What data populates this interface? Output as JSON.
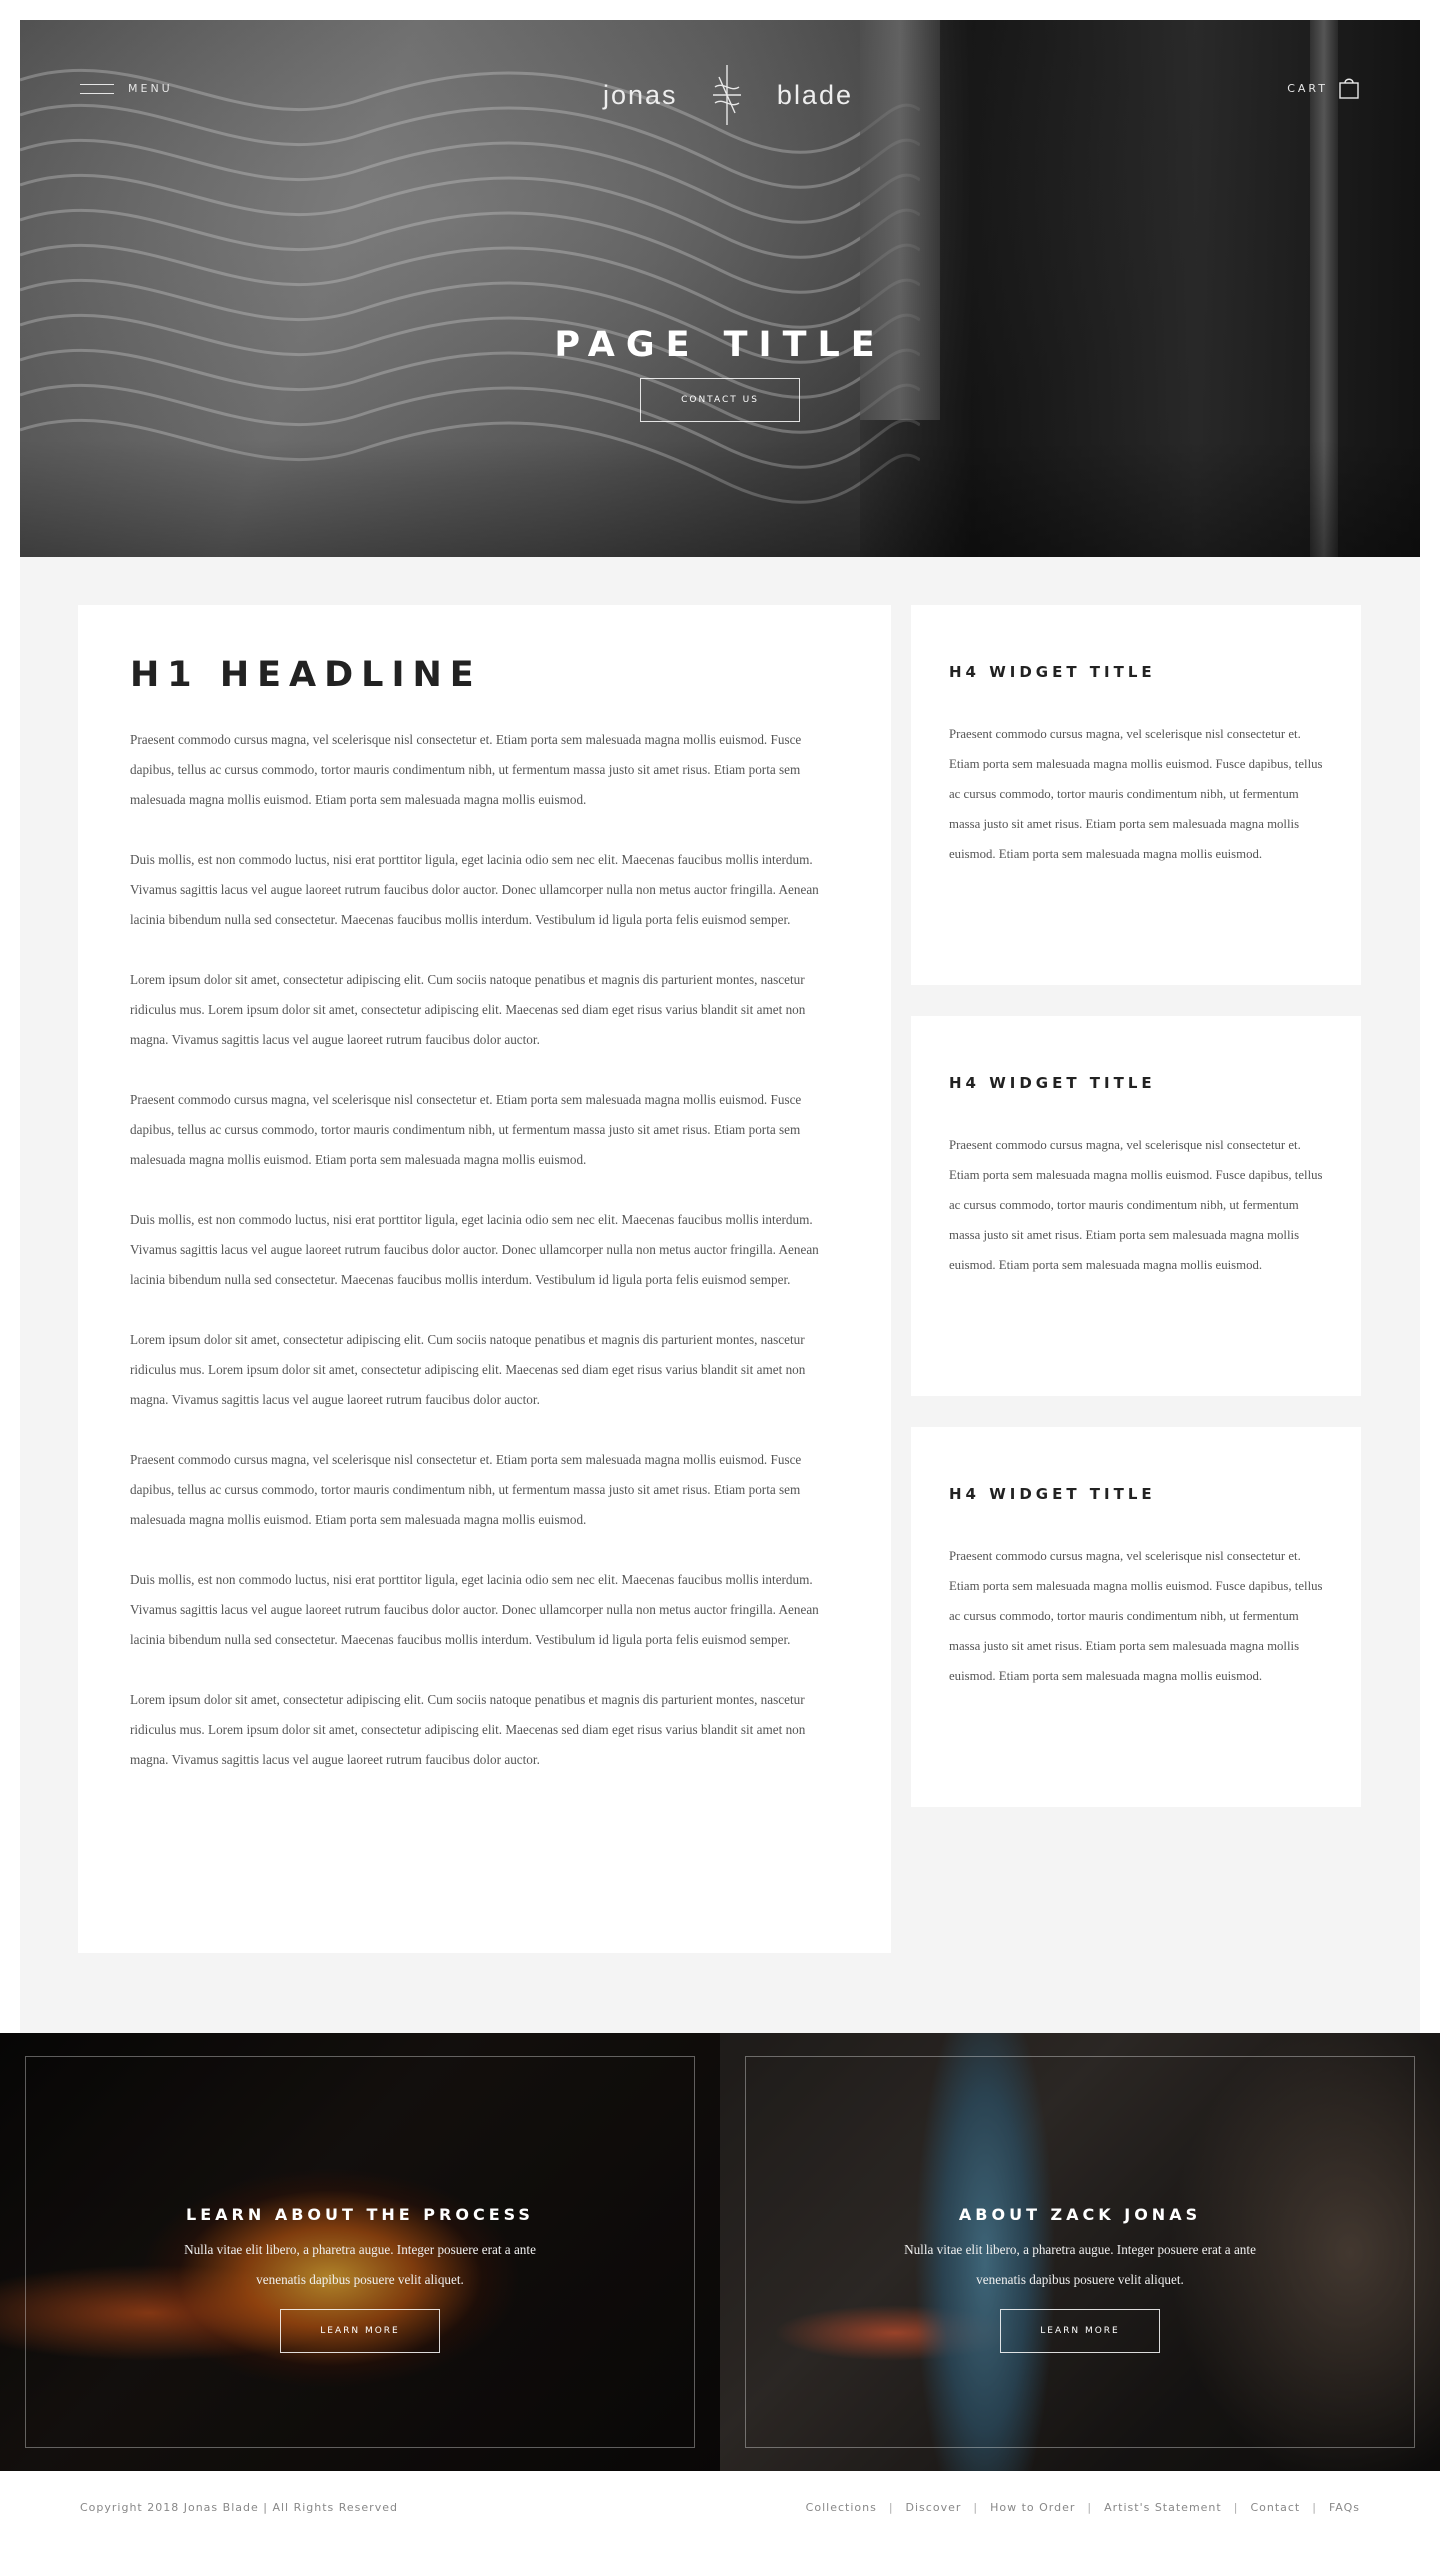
{
  "header": {
    "menu_label": "MENU",
    "logo_left": "jonas",
    "logo_right": "blade",
    "cart_label": "CART"
  },
  "hero": {
    "title": "PAGE TITLE",
    "cta_label": "CONTACT US"
  },
  "main": {
    "headline": "H1 HEADLINE",
    "paragraphs": [
      "Praesent commodo cursus magna, vel scelerisque nisl consectetur et. Etiam porta sem malesuada magna mollis euismod. Fusce dapibus, tellus ac cursus commodo, tortor mauris condimentum nibh, ut fermentum massa justo sit amet risus. Etiam porta sem malesuada magna mollis euismod. Etiam porta sem malesuada magna mollis euismod.",
      "Duis mollis, est non commodo luctus, nisi erat porttitor ligula, eget lacinia odio sem nec elit. Maecenas faucibus mollis interdum. Vivamus sagittis lacus vel augue laoreet rutrum faucibus dolor auctor. Donec ullamcorper nulla non metus auctor fringilla. Aenean lacinia bibendum nulla sed consectetur. Maecenas faucibus mollis interdum. Vestibulum id ligula porta felis euismod semper.",
      "Lorem ipsum dolor sit amet, consectetur adipiscing elit. Cum sociis natoque penatibus et magnis dis parturient montes, nascetur ridiculus mus. Lorem ipsum dolor sit amet, consectetur adipiscing elit. Maecenas sed diam eget risus varius blandit sit amet non magna. Vivamus sagittis lacus vel augue laoreet rutrum faucibus dolor auctor.",
      "Praesent commodo cursus magna, vel scelerisque nisl consectetur et. Etiam porta sem malesuada magna mollis euismod. Fusce dapibus, tellus ac cursus commodo, tortor mauris condimentum nibh, ut fermentum massa justo sit amet risus. Etiam porta sem malesuada magna mollis euismod. Etiam porta sem malesuada magna mollis euismod.",
      "Duis mollis, est non commodo luctus, nisi erat porttitor ligula, eget lacinia odio sem nec elit. Maecenas faucibus mollis interdum. Vivamus sagittis lacus vel augue laoreet rutrum faucibus dolor auctor. Donec ullamcorper nulla non metus auctor fringilla. Aenean lacinia bibendum nulla sed consectetur. Maecenas faucibus mollis interdum. Vestibulum id ligula porta felis euismod semper.",
      "Lorem ipsum dolor sit amet, consectetur adipiscing elit. Cum sociis natoque penatibus et magnis dis parturient montes, nascetur ridiculus mus. Lorem ipsum dolor sit amet, consectetur adipiscing elit. Maecenas sed diam eget risus varius blandit sit amet non magna. Vivamus sagittis lacus vel augue laoreet rutrum faucibus dolor auctor.",
      "Praesent commodo cursus magna, vel scelerisque nisl consectetur et. Etiam porta sem malesuada magna mollis euismod. Fusce dapibus, tellus ac cursus commodo, tortor mauris condimentum nibh, ut fermentum massa justo sit amet risus. Etiam porta sem malesuada magna mollis euismod. Etiam porta sem malesuada magna mollis euismod.",
      "Duis mollis, est non commodo luctus, nisi erat porttitor ligula, eget lacinia odio sem nec elit. Maecenas faucibus mollis interdum. Vivamus sagittis lacus vel augue laoreet rutrum faucibus dolor auctor. Donec ullamcorper nulla non metus auctor fringilla. Aenean lacinia bibendum nulla sed consectetur. Maecenas faucibus mollis interdum. Vestibulum id ligula porta felis euismod semper.",
      "Lorem ipsum dolor sit amet, consectetur adipiscing elit. Cum sociis natoque penatibus et magnis dis parturient montes, nascetur ridiculus mus. Lorem ipsum dolor sit amet, consectetur adipiscing elit. Maecenas sed diam eget risus varius blandit sit amet non magna. Vivamus sagittis lacus vel augue laoreet rutrum faucibus dolor auctor."
    ]
  },
  "widgets": [
    {
      "title": "H4 WIDGET TITLE",
      "text": "Praesent commodo cursus magna, vel scelerisque nisl consectetur et. Etiam porta sem malesuada magna mollis euismod. Fusce dapibus, tellus ac cursus commodo, tortor mauris condimentum nibh, ut fermentum massa justo sit amet risus. Etiam porta sem malesuada magna mollis euismod. Etiam porta sem malesuada magna mollis euismod."
    },
    {
      "title": "H4 WIDGET TITLE",
      "text": "Praesent commodo cursus magna, vel scelerisque nisl consectetur et. Etiam porta sem malesuada magna mollis euismod. Fusce dapibus, tellus ac cursus commodo, tortor mauris condimentum nibh, ut fermentum massa justo sit amet risus. Etiam porta sem malesuada magna mollis euismod. Etiam porta sem malesuada magna mollis euismod."
    },
    {
      "title": "H4 WIDGET TITLE",
      "text": "Praesent commodo cursus magna, vel scelerisque nisl consectetur et. Etiam porta sem malesuada magna mollis euismod. Fusce dapibus, tellus ac cursus commodo, tortor mauris condimentum nibh, ut fermentum massa justo sit amet risus. Etiam porta sem malesuada magna mollis euismod. Etiam porta sem malesuada magna mollis euismod."
    }
  ],
  "promos": [
    {
      "title": "LEARN ABOUT THE PROCESS",
      "text": "Nulla vitae elit libero, a pharetra augue. Integer posuere erat a ante venenatis dapibus posuere velit aliquet.",
      "button": "LEARN MORE"
    },
    {
      "title": "ABOUT ZACK JONAS",
      "text": "Nulla vitae elit libero, a pharetra augue. Integer posuere erat a ante venenatis dapibus posuere velit aliquet.",
      "button": "LEARN MORE"
    }
  ],
  "footer": {
    "copyright": "Copyright 2018 Jonas Blade | All Rights Reserved",
    "links": [
      "Collections",
      "Discover",
      "How to Order",
      "Artist's Statement",
      "Contact",
      "FAQs"
    ]
  },
  "icons": {
    "menu": "hamburger-icon",
    "cart": "shopping-bag-icon",
    "logo": "blade-mark-icon"
  },
  "colors": {
    "content_bg": "#f4f4f4",
    "card_bg": "#ffffff",
    "heading": "#222222",
    "body_text": "#555555",
    "footer_text": "#888888"
  }
}
